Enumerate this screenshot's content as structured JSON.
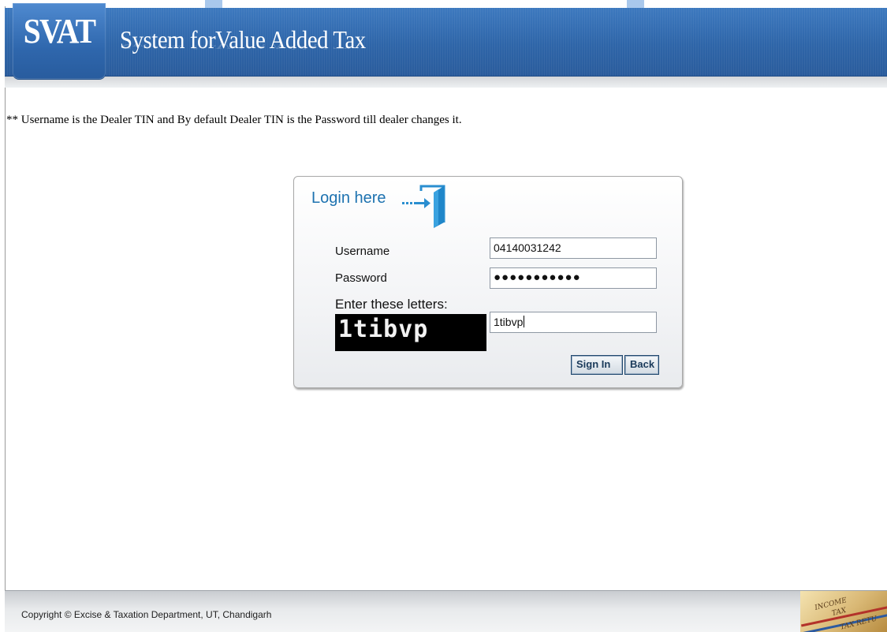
{
  "header": {
    "logo_text": "SVAT",
    "title": "System forValue Added Tax"
  },
  "info_note": "** Username is the Dealer TIN and By default Dealer TIN is the Password till dealer changes it.",
  "login": {
    "title": "Login here",
    "username_label": "Username",
    "username_value": "04140031242",
    "password_label": "Password",
    "password_masked": "●●●●●●●●●●●",
    "captcha_caption": "Enter these letters:",
    "captcha_image_text": "1tibvp",
    "captcha_value": "1tibvp",
    "signin_label": "Sign In",
    "back_label": "Back"
  },
  "footer": {
    "copyright": "Copyright © Excise & Taxation Department, UT, Chandigarh",
    "art_text_1": "INCOME",
    "art_text_2": "TAX",
    "art_text_3": "TAX RETU"
  },
  "colors": {
    "header_blue": "#2e65a8",
    "login_title_blue": "#1d72b0"
  },
  "icons": [
    "door-enter-icon"
  ]
}
